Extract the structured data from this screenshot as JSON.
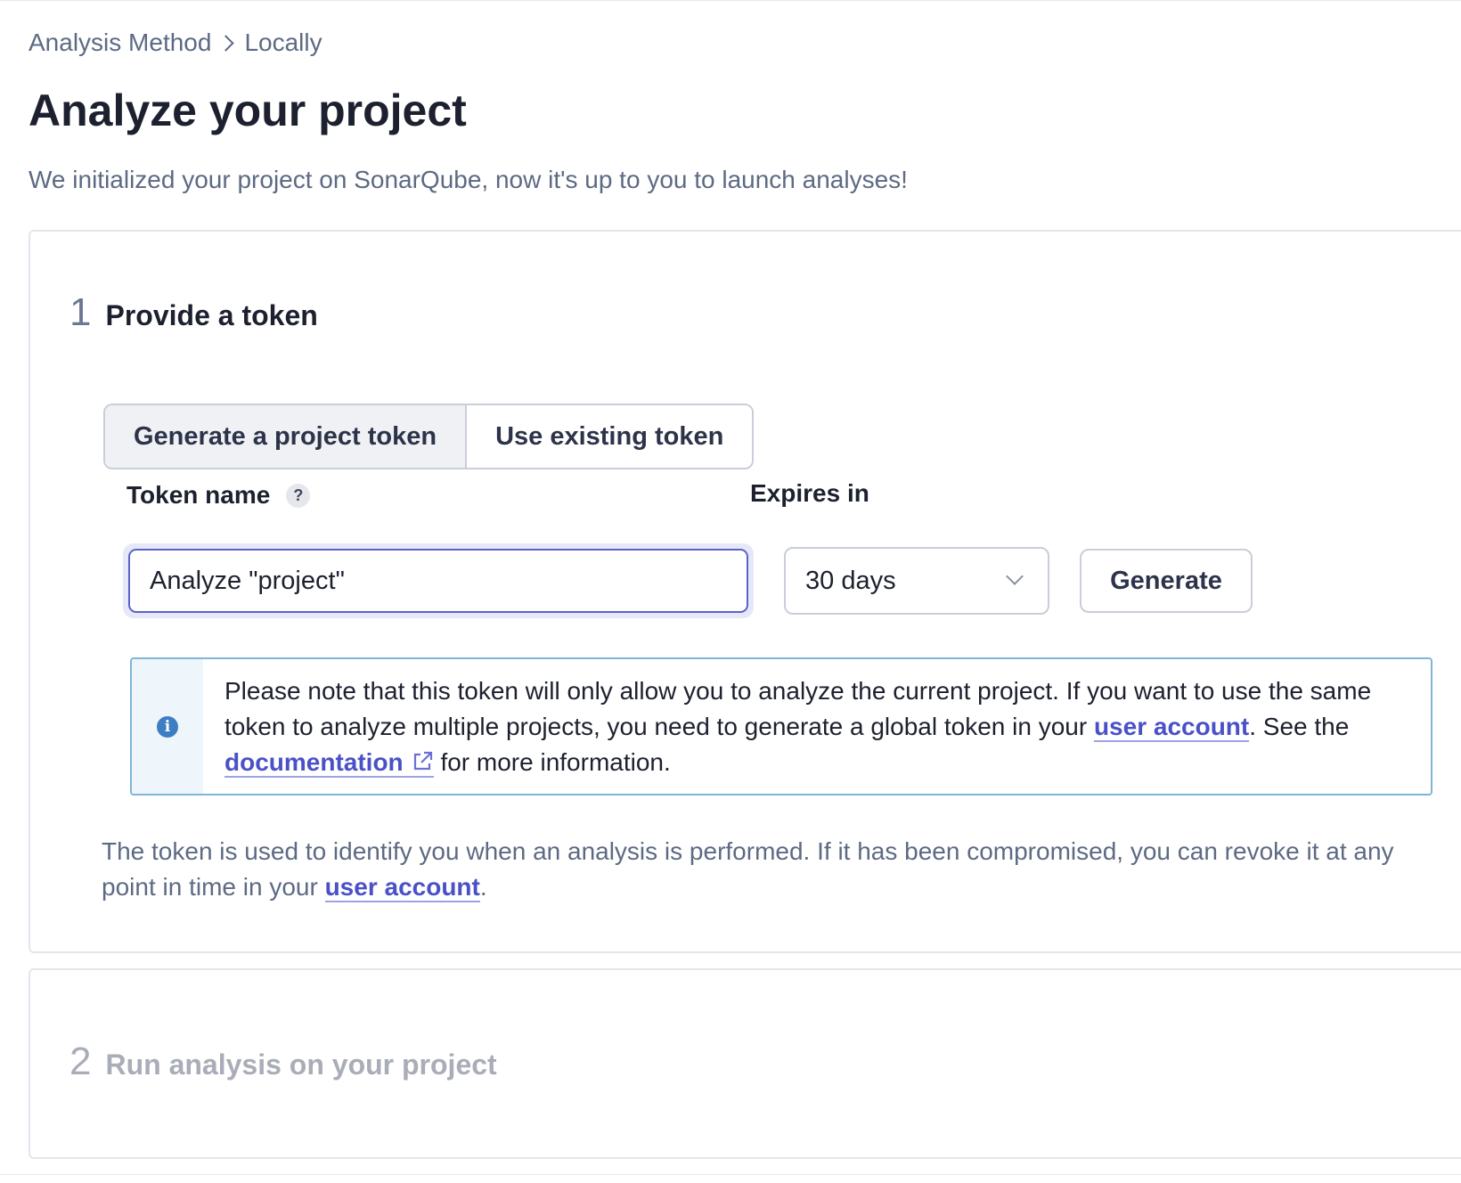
{
  "breadcrumb": {
    "items": [
      "Analysis Method",
      "Locally"
    ]
  },
  "page": {
    "title": "Analyze your project",
    "subtitle": "We initialized your project on SonarQube, now it's up to you to launch analyses!"
  },
  "step1": {
    "number": "1",
    "title": "Provide a token",
    "tabs": [
      {
        "label": "Generate a project token",
        "selected": true
      },
      {
        "label": "Use existing token",
        "selected": false
      }
    ],
    "token_name_label": "Token name",
    "help_icon_glyph": "?",
    "token_name_value": "Analyze \"project\"",
    "expires_label": "Expires in",
    "expires_value": "30 days",
    "generate_label": "Generate",
    "info": {
      "icon": "info-icon",
      "part1": "Please note that this token will only allow you to analyze the current project. If you want to use the same token to analyze multiple projects, you need to generate a global token in your ",
      "link1": "user account",
      "part2": ". See the ",
      "link2": "documentation",
      "part3": " for more information."
    },
    "note": {
      "part1": "The token is used to identify you when an analysis is performed. If it has been compromised, you can revoke it at any point in time in your ",
      "link": "user account",
      "part2": "."
    }
  },
  "step2": {
    "number": "2",
    "title": "Run analysis on your project"
  },
  "colors": {
    "accent": "#5b62c9",
    "link": "#4a51c7",
    "info_border": "#7fb5d9",
    "muted": "#5d6a83"
  }
}
